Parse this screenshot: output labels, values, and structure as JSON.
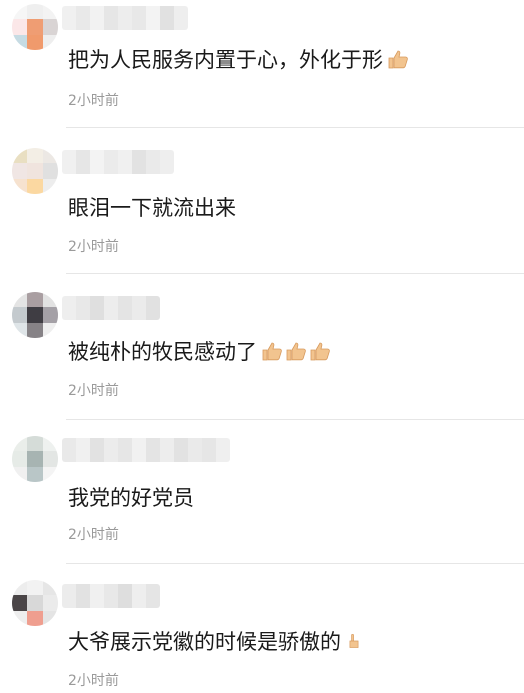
{
  "comments": [
    {
      "text": "把为人民服务内置于心，外化于形",
      "thumbs": 1,
      "time": "2小时前"
    },
    {
      "text": "眼泪一下就流出来",
      "thumbs": 0,
      "time": "2小时前"
    },
    {
      "text": "被纯朴的牧民感动了",
      "thumbs": 3,
      "time": "2小时前"
    },
    {
      "text": "我党的好党员",
      "thumbs": 0,
      "time": "2小时前"
    },
    {
      "text": "大爷展示党徽的时候是骄傲的",
      "thumbs": 1,
      "time": "2小时前"
    }
  ],
  "colors": {
    "text": "#1a1a1a",
    "timestamp": "#9a9a9a",
    "divider": "#e6e6e6",
    "thumb": "#f2c48f"
  },
  "icons": {
    "reaction": "thumbs-up-icon"
  }
}
